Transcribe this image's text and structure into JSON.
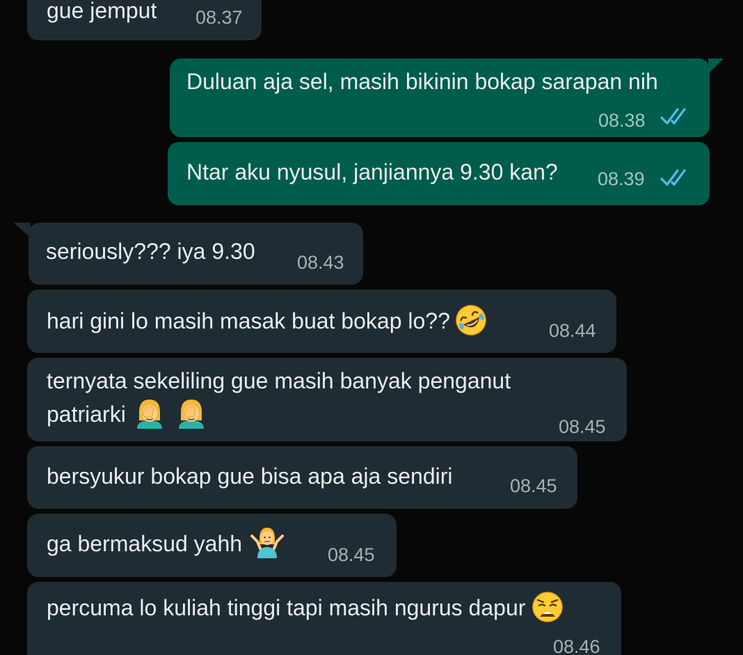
{
  "messages": [
    {
      "id": "m1",
      "direction": "incoming",
      "text": "gue jemput",
      "time": "08.37"
    },
    {
      "id": "m2",
      "direction": "outgoing",
      "text": "Duluan aja sel, masih bikinin bokap sarapan nih",
      "time": "08.38",
      "status": "read"
    },
    {
      "id": "m3",
      "direction": "outgoing",
      "text": "Ntar aku nyusul, janjiannya 9.30 kan?",
      "time": "08.39",
      "status": "read"
    },
    {
      "id": "m4",
      "direction": "incoming",
      "text": "seriously??? iya 9.30",
      "time": "08.43"
    },
    {
      "id": "m5",
      "direction": "incoming",
      "text": "hari gini lo masih masak buat bokap lo??",
      "emoji": "rolling-laughing-emoji",
      "time": "08.44"
    },
    {
      "id": "m6",
      "direction": "incoming",
      "text_line1": "ternyata sekeliling gue masih banyak penganut",
      "text_line2": "patriarki",
      "emoji": "facepalm-emoji",
      "time": "08.45"
    },
    {
      "id": "m7",
      "direction": "incoming",
      "text": "bersyukur bokap gue bisa apa aja sendiri",
      "time": "08.45"
    },
    {
      "id": "m8",
      "direction": "incoming",
      "text": "ga bermaksud yahh",
      "emoji": "shrug-emoji",
      "time": "08.45"
    },
    {
      "id": "m9",
      "direction": "incoming",
      "text": "percuma lo kuliah tinggi tapi masih ngurus dapur",
      "emoji": "weary-face-emoji",
      "time": "08.46"
    }
  ],
  "colors": {
    "background": "#070707",
    "incoming_bubble": "#202c33",
    "outgoing_bubble": "#005c4b",
    "read_check": "#53bdeb",
    "text": "#e9edef"
  }
}
